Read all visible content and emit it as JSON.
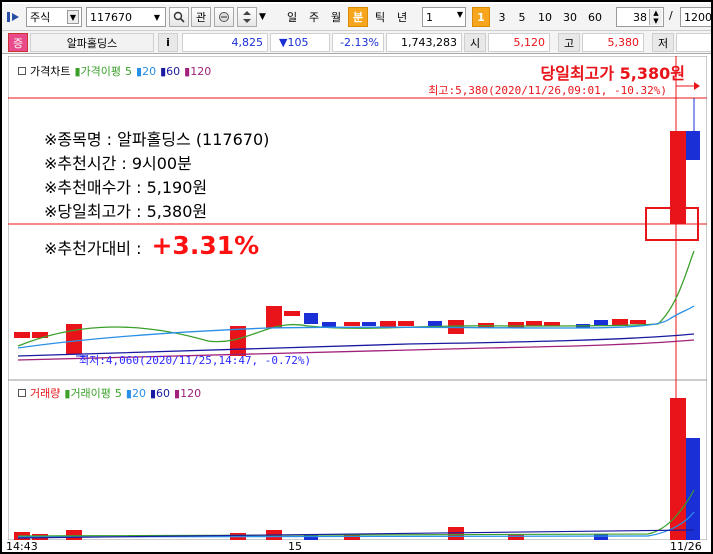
{
  "toolbar": {
    "market": "주식",
    "code": "117670",
    "fav": "관",
    "periods": [
      "일",
      "주",
      "월",
      "분",
      "틱",
      "년"
    ],
    "active_period": "분",
    "interval_value": "1",
    "minute_options": [
      "1",
      "3",
      "5",
      "10",
      "30",
      "60"
    ],
    "active_minute": "1",
    "count_value": "38",
    "total_value": "1200"
  },
  "quote": {
    "tag": "증",
    "name": "알파홀딩스",
    "info": "i",
    "price": "4,825",
    "change": "▼105",
    "change_pct": "-2.13%",
    "volume": "1,743,283",
    "open_label": "시",
    "open": "5,120",
    "high_label": "고",
    "high": "5,380",
    "low_label": "저"
  },
  "price_pane": {
    "legend": {
      "title": "가격차트",
      "ma_title": "가격이평",
      "ma_periods": [
        "5",
        "20",
        "60",
        "120"
      ]
    },
    "max_title": "당일최고가 5,380원",
    "max_note": "최고:5,380(2020/11/26,09:01, -10.32%)",
    "min_note": "최저:4,060(2020/11/25,14:47, -0.72%)"
  },
  "recommendation": {
    "name_line": "※종목명 : 알파홀딩스 (117670)",
    "time_line": "※추천시간 : 9시00분",
    "buy_line": "※추천매수가 : 5,190원",
    "high_line": "※당일최고가 : 5,380원",
    "ratio_label": "※추천가대비 :",
    "ratio_value": "+3.31%"
  },
  "volume_pane": {
    "legend": {
      "title": "거래량",
      "ma_title": "거래이평",
      "ma_periods": [
        "5",
        "20",
        "60",
        "120"
      ]
    }
  },
  "x_axis": {
    "labels": [
      "14:43",
      "15",
      "11/26"
    ]
  },
  "colors": {
    "up": "#e8141a",
    "down": "#1a2fd6",
    "ma5": "#3aa02a",
    "ma20": "#2a8fe6",
    "ma60": "#1a1aa0",
    "ma120": "#a0207a",
    "accent": "#f7a51c"
  }
}
